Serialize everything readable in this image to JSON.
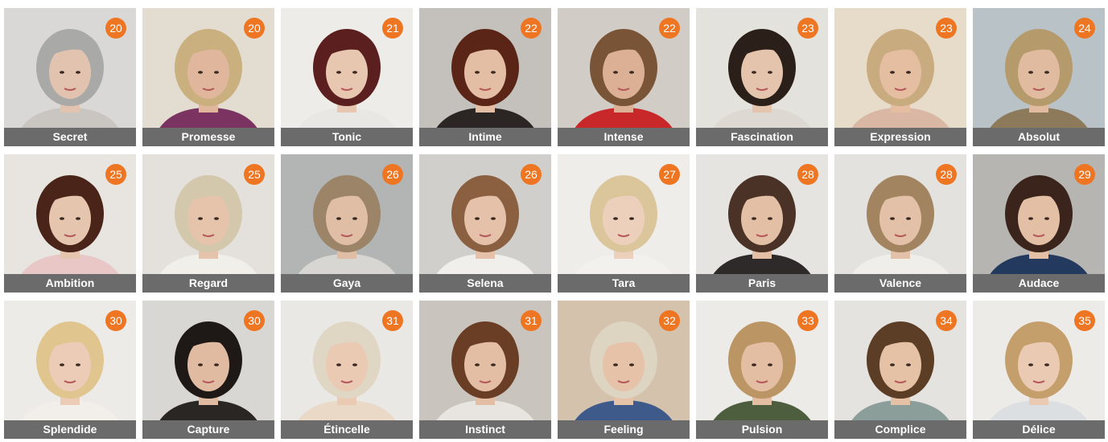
{
  "colors": {
    "badge": "#ee7623",
    "label_bar": "#6b6b6b",
    "label_text": "#ffffff"
  },
  "wigs": [
    {
      "name": "Secret",
      "page": "20",
      "hair": "#a9aaa8",
      "bg": "#d9d8d6",
      "skin": "#e2c3b0",
      "cloth": "#c9c6c2"
    },
    {
      "name": "Promesse",
      "page": "20",
      "hair": "#c9b07e",
      "bg": "#e3dcd1",
      "skin": "#e0b79c",
      "cloth": "#7b3461"
    },
    {
      "name": "Tonic",
      "page": "21",
      "hair": "#5a1f1e",
      "bg": "#eeece8",
      "skin": "#e7c7b0",
      "cloth": "#e9e7e3"
    },
    {
      "name": "Intime",
      "page": "22",
      "hair": "#5a2416",
      "bg": "#c4c1bd",
      "skin": "#e3bda4",
      "cloth": "#2b2624"
    },
    {
      "name": "Intense",
      "page": "22",
      "hair": "#7a5436",
      "bg": "#d1ccc6",
      "skin": "#dcb095",
      "cloth": "#c9282b"
    },
    {
      "name": "Fascination",
      "page": "23",
      "hair": "#2b1f1a",
      "bg": "#e4e2dd",
      "skin": "#e5c4ad",
      "cloth": "#ddd9d2"
    },
    {
      "name": "Expression",
      "page": "23",
      "hair": "#c8ab7f",
      "bg": "#e6dcc9",
      "skin": "#e5bea2",
      "cloth": "#d9b7a4"
    },
    {
      "name": "Absolut",
      "page": "24",
      "hair": "#b59a6c",
      "bg": "#b9c2c6",
      "skin": "#e0bb9f",
      "cloth": "#8c7a5b"
    },
    {
      "name": "Ambition",
      "page": "25",
      "hair": "#4a2418",
      "bg": "#e8e5e1",
      "skin": "#e6c5ae",
      "cloth": "#e8c7c6"
    },
    {
      "name": "Regard",
      "page": "25",
      "hair": "#d3c7ac",
      "bg": "#e4e1dc",
      "skin": "#e5c4ab",
      "cloth": "#f1efea"
    },
    {
      "name": "Gaya",
      "page": "26",
      "hair": "#9c8468",
      "bg": "#b3b5b5",
      "skin": "#e0bea6",
      "cloth": "#d8d6d3"
    },
    {
      "name": "Selena",
      "page": "26",
      "hair": "#8a6040",
      "bg": "#d0cfcc",
      "skin": "#e5c1a9",
      "cloth": "#f1efeb"
    },
    {
      "name": "Tara",
      "page": "27",
      "hair": "#dbc69c",
      "bg": "#efede9",
      "skin": "#ecd0bb",
      "cloth": "#f3f1ee"
    },
    {
      "name": "Paris",
      "page": "28",
      "hair": "#4a3226",
      "bg": "#e6e4e1",
      "skin": "#e3bfa6",
      "cloth": "#2d2a29"
    },
    {
      "name": "Valence",
      "page": "28",
      "hair": "#a38461",
      "bg": "#e4e2df",
      "skin": "#e3c1a8",
      "cloth": "#f0eeeb"
    },
    {
      "name": "Audace",
      "page": "29",
      "hair": "#3a241b",
      "bg": "#b7b5b2",
      "skin": "#e3bfa5",
      "cloth": "#233a5e"
    },
    {
      "name": "Splendide",
      "page": "30",
      "hair": "#e1c58f",
      "bg": "#ecebe8",
      "skin": "#ecccb6",
      "cloth": "#f2efea"
    },
    {
      "name": "Capture",
      "page": "30",
      "hair": "#1e1816",
      "bg": "#d9d7d3",
      "skin": "#e0bba1",
      "cloth": "#2a2624"
    },
    {
      "name": "Étincelle",
      "page": "31",
      "hair": "#e0d6c4",
      "bg": "#e9e8e5",
      "skin": "#ebcab4",
      "cloth": "#e9d9c6"
    },
    {
      "name": "Instinct",
      "page": "31",
      "hair": "#6a3d25",
      "bg": "#c9c4be",
      "skin": "#e3bea4",
      "cloth": "#e8e5e0"
    },
    {
      "name": "Feeling",
      "page": "32",
      "hair": "#ddd4c2",
      "bg": "#d4c2ad",
      "skin": "#e6c2a9",
      "cloth": "#3e5a8a"
    },
    {
      "name": "Pulsion",
      "page": "33",
      "hair": "#bb9564",
      "bg": "#ecebe8",
      "skin": "#e3bea3",
      "cloth": "#4c5e3d"
    },
    {
      "name": "Complice",
      "page": "34",
      "hair": "#5c3d26",
      "bg": "#e5e3df",
      "skin": "#e5c1a6",
      "cloth": "#8b9e9a"
    },
    {
      "name": "Délice",
      "page": "35",
      "hair": "#c49f6c",
      "bg": "#ecebe8",
      "skin": "#ebcab3",
      "cloth": "#dcdfe2"
    }
  ]
}
